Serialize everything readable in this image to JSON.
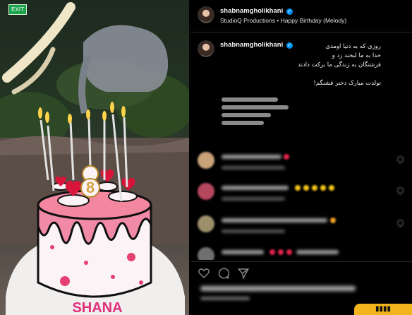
{
  "post": {
    "username": "shabnamgholikhani",
    "verified_mark": "✓",
    "subtitle": "StudioQ Productions • Happy Birthday (Melody)",
    "caption_lines": [
      "روزی که به دنیا اومدی",
      "خدا به ما لبخند زد و",
      "فرشتگان به زندگی ما برکت دادند",
      "تولدت مبارک دختر قشنگم!"
    ]
  },
  "media": {
    "exit_sign": "EXIT",
    "candle_number": "8",
    "cake_text": "SHANA"
  },
  "actions": {
    "like_icon": "heart-icon",
    "comment_icon": "comment-icon",
    "share_icon": "send-icon"
  },
  "colors": {
    "background": "#000000",
    "verified": "#0095f6",
    "cake_pink": "#f08aa6",
    "badge": "#f2b41c"
  }
}
